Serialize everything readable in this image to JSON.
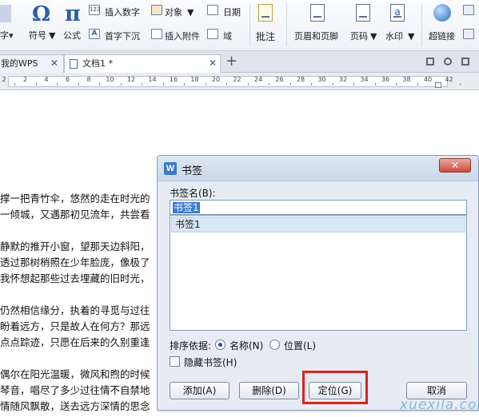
{
  "ribbon": {
    "partial_left_label": "字▾",
    "symbol_label": "符号",
    "formula_label": "公式",
    "insert_number_label": "插入数字",
    "first_char_sink_label": "首字下沉",
    "object_label": "对象",
    "insert_attachment_label": "插入附件",
    "date_label": "日期",
    "field_label": "域",
    "annotate_label": "批注",
    "header_footer_label": "页眉和页脚",
    "page_number_label": "页码",
    "watermark_label": "水印",
    "hyperlink_label": "超链接"
  },
  "tabs": [
    {
      "label": "我的WPS",
      "active": false
    },
    {
      "label": "文档1 *",
      "active": true
    }
  ],
  "ruler": {
    "numbers": [
      "2",
      "2",
      "4",
      "6",
      "8",
      "10",
      "12",
      "14",
      "16",
      "18",
      "20",
      "22",
      "24",
      "26",
      "28",
      "30",
      "32",
      "34",
      "36",
      "38",
      "40",
      "42"
    ]
  },
  "document": {
    "lines": [
      "撑一把青竹伞，悠然的走在时光的",
      "一倾城，又遇那初见流年，共尝看",
      "静默的推开小窗，望那天边斜阳，",
      "透过那树梢照在少年脸庞，像极了",
      "我怀想起那些过去埋藏的旧时光，",
      "仍然相信缘分，执着的寻觅与过往",
      "盼着远方，只是故人在何方？那远",
      "点点踪迹，只愿在后来的久别重逢",
      "偶尔在阳光温暖，微风和煦的时候",
      "琴音，唱尽了多少过往情不自禁地",
      "情随风飘散，送去远方深情的思念"
    ]
  },
  "dialog": {
    "title": "书签",
    "close_symbol": "✕",
    "name_label": "书签名(B):",
    "name_value": "书签1",
    "list_items": [
      "书签1"
    ],
    "sort_label": "排序依据:",
    "sort_options": [
      {
        "label": "名称(N)",
        "selected": true
      },
      {
        "label": "位置(L)",
        "selected": false
      }
    ],
    "hidden_bookmarks_label": "隐藏书签(H)",
    "hidden_bookmarks_checked": false,
    "buttons": {
      "add": "添加(A)",
      "delete": "删除(D)",
      "goto": "定位(G)",
      "cancel": "取消"
    }
  },
  "watermark_text": "xuexila.com",
  "colors": {
    "highlight_box": "#d9231d",
    "selection": "#3a7bd5",
    "close_button": "#c9493a"
  }
}
